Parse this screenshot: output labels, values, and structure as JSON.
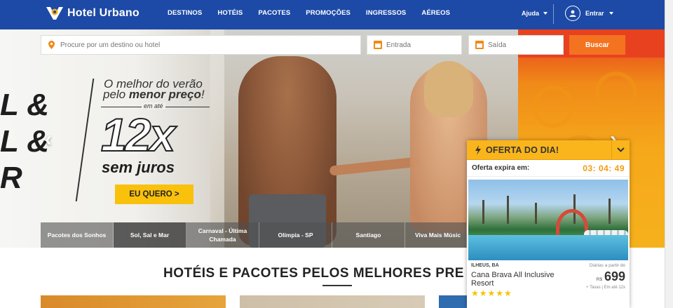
{
  "header": {
    "brand": "Hotel Urbano",
    "nav": [
      "DESTINOS",
      "HOTÉIS",
      "PACOTES",
      "PROMOÇÕES",
      "INGRESSOS",
      "AÉREOS"
    ],
    "help": "Ajuda",
    "login": "Entrar"
  },
  "search": {
    "destination_placeholder": "Procure por um destino ou hotel",
    "checkin_placeholder": "Entrada",
    "checkout_placeholder": "Saída",
    "button": "Buscar"
  },
  "hero": {
    "big_letters": [
      "L &",
      "L &",
      "R"
    ],
    "line1": "O melhor do verão",
    "line2_prefix": "pelo ",
    "line2_bold": "menor preço",
    "line2_suffix": "!",
    "em_ate": "em até",
    "installments": "12x",
    "sem_juros": "sem juros",
    "cta": "EU QUERO >",
    "prev": "‹",
    "next": "›",
    "tabs": [
      "Pacotes dos Sonhos",
      "Sol, Sal e Mar",
      "Carnaval - Última Chamada",
      "Olímpia - SP",
      "Santiago",
      "Viva Mais Músic"
    ]
  },
  "offer": {
    "title": "OFERTA DO DIA!",
    "expires_label": "Oferta expira em:",
    "timer": "03: 04: 49",
    "location": "ILHEUS, BA",
    "hotel_name": "Cana Brava All Inclusive Resort",
    "stars": "★★★★★",
    "price_label": "Diárias a partir de",
    "currency": "R$",
    "price": "699",
    "price_note": "+ Taxas | Em até 12x"
  },
  "section": {
    "title": "HOTÉIS E PACOTES PELOS MELHORES PRE"
  },
  "colors": {
    "header_blue": "#1d4aa6",
    "accent_orange": "#f37321",
    "offer_yellow": "#f9b51b",
    "cta_yellow": "#f9c10b",
    "timer_orange": "#f39c12"
  }
}
